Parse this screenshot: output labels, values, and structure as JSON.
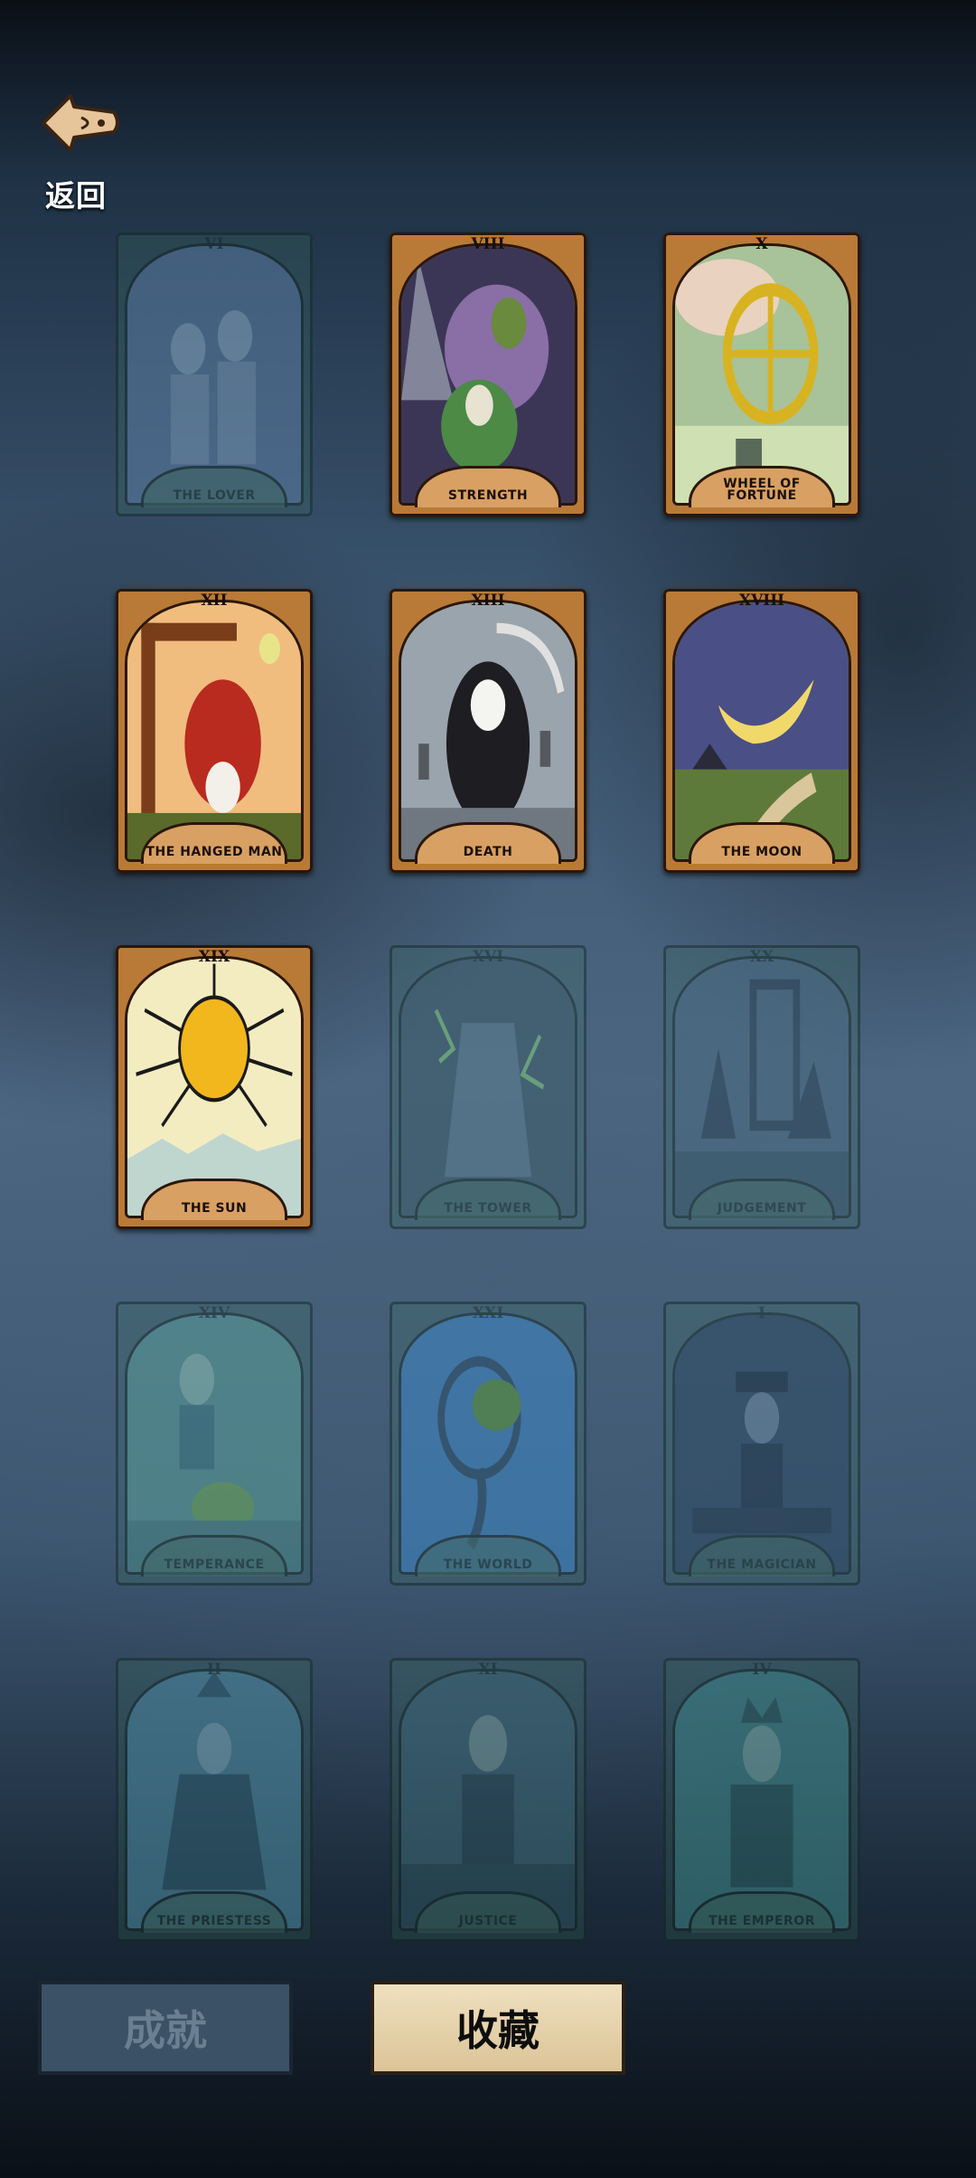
{
  "header": {
    "back_label": "返回"
  },
  "cards": [
    {
      "numeral": "VI",
      "name": "THE LOVER",
      "unlocked": false,
      "art": "#5d7fa5"
    },
    {
      "numeral": "VIII",
      "name": "STRENGTH",
      "unlocked": true,
      "art": "#3c3656"
    },
    {
      "numeral": "X",
      "name": "WHEEL OF FORTUNE",
      "unlocked": true,
      "art": "#a8c29a"
    },
    {
      "numeral": "XII",
      "name": "THE HANGED MAN",
      "unlocked": true,
      "art": "#f0bd7f"
    },
    {
      "numeral": "XIII",
      "name": "DEATH",
      "unlocked": true,
      "art": "#9aa4ad"
    },
    {
      "numeral": "XVIII",
      "name": "THE MOON",
      "unlocked": true,
      "art": "#4a4f86"
    },
    {
      "numeral": "XIX",
      "name": "THE SUN",
      "unlocked": true,
      "art": "#f4ecc1"
    },
    {
      "numeral": "XVI",
      "name": "THE TOWER",
      "unlocked": false,
      "art": "#3f5f6b"
    },
    {
      "numeral": "XX",
      "name": "JUDGEMENT",
      "unlocked": false,
      "art": "#4a6c80"
    },
    {
      "numeral": "XIV",
      "name": "TEMPERANCE",
      "unlocked": false,
      "art": "#5aa09a"
    },
    {
      "numeral": "XXI",
      "name": "THE WORLD",
      "unlocked": false,
      "art": "#3d88c8"
    },
    {
      "numeral": "I",
      "name": "THE MAGICIAN",
      "unlocked": false,
      "art": "#2f4b63"
    },
    {
      "numeral": "II",
      "name": "THE PRIESTESS",
      "unlocked": false,
      "art": "#4f8fa5"
    },
    {
      "numeral": "XI",
      "name": "JUSTICE",
      "unlocked": false,
      "art": "#3e6b78"
    },
    {
      "numeral": "IV",
      "name": "THE EMPEROR",
      "unlocked": false,
      "art": "#3f8b8b"
    }
  ],
  "tabs": {
    "achievements_label": "成就",
    "collection_label": "收藏"
  }
}
